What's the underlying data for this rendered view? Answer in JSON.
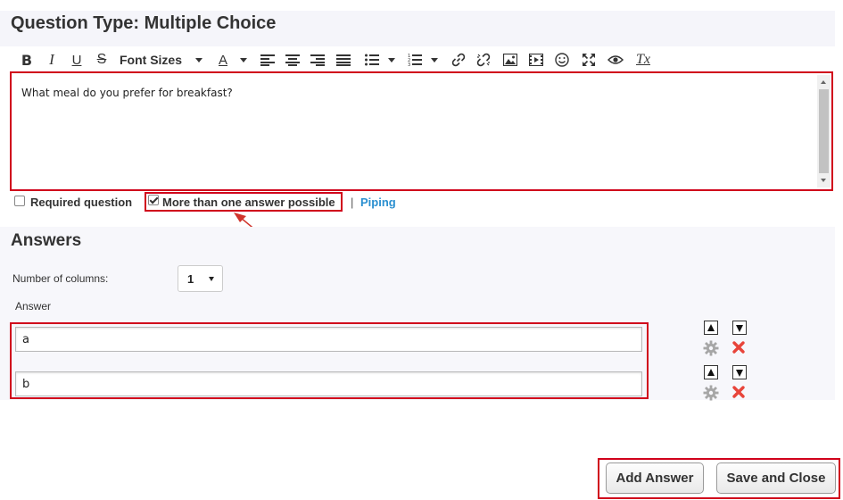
{
  "question": {
    "title": "Question Type: Multiple Choice",
    "text": "What meal do you prefer for breakfast?"
  },
  "toolbar": {
    "font_sizes_label": "Font Sizes",
    "font_color_label": "A",
    "clear_format_label": "Tx",
    "icons": [
      "bold-icon",
      "italic-icon",
      "underline-icon",
      "strikethrough-icon",
      "font-color-icon",
      "align-left-icon",
      "align-center-icon",
      "align-right-icon",
      "justify-icon",
      "bullet-list-icon",
      "numbered-list-icon",
      "link-icon",
      "unlink-icon",
      "image-icon",
      "video-icon",
      "emoji-icon",
      "fullscreen-icon",
      "preview-eye-icon",
      "clear-format-icon"
    ]
  },
  "options": {
    "required_label": "Required question",
    "required_checked": false,
    "multiple_label": "More than one answer possible",
    "multiple_checked": true,
    "separator": "|",
    "piping_label": "Piping"
  },
  "answers": {
    "title": "Answers",
    "columns_label": "Number of columns:",
    "columns_value": "1",
    "answer_header": "Answer",
    "items": [
      {
        "value": "a"
      },
      {
        "value": "b"
      }
    ]
  },
  "buttons": {
    "add_answer": "Add Answer",
    "save_close": "Save and Close"
  },
  "colors": {
    "highlight": "#d0021b",
    "link": "#2a8fd0",
    "delete": "#e8443a"
  }
}
